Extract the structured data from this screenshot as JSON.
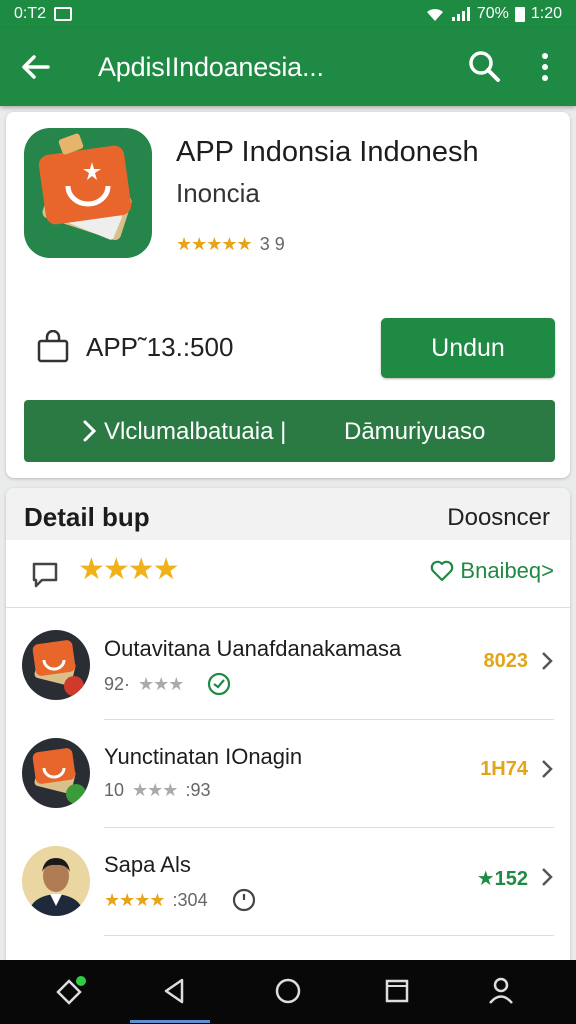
{
  "status_bar": {
    "left_time": "0:T2",
    "battery": "70%",
    "clock": "1:20"
  },
  "app_bar": {
    "title": "ApdisIIndoanesia..."
  },
  "app": {
    "name": "APP Indonsia Indonesh",
    "subtitle": "Inoncia",
    "stars": "★★★★★",
    "rating_count": "3 9",
    "price": "APP˜13.:500",
    "install_label": "Undun",
    "wide_left": "Vlclumalbatuaia |",
    "wide_right": "Dāmuriyuaso"
  },
  "details": {
    "title": "Detail bup",
    "developer": "Doosncer",
    "stars": "★★★★",
    "follow_label": "Bnaibeq>"
  },
  "items": [
    {
      "name": "Outavitana Uanafdanakamasa",
      "prefix": "92·",
      "stars": "★★★",
      "suffix": "",
      "value": "8023",
      "value_color": "#e2a51a"
    },
    {
      "name": "Yunctinatan IOnagin",
      "prefix": "10",
      "stars": "★★★",
      "suffix": ":93",
      "value": "1H74",
      "value_color": "#e2a51a"
    },
    {
      "name": "Sapa Als",
      "prefix": "",
      "stars": "★★★★",
      "suffix": ":304",
      "value": "★152",
      "value_color": "#1f8a44"
    }
  ],
  "colors": {
    "primary": "#1f8a44",
    "accent_gold": "#e8a317"
  }
}
